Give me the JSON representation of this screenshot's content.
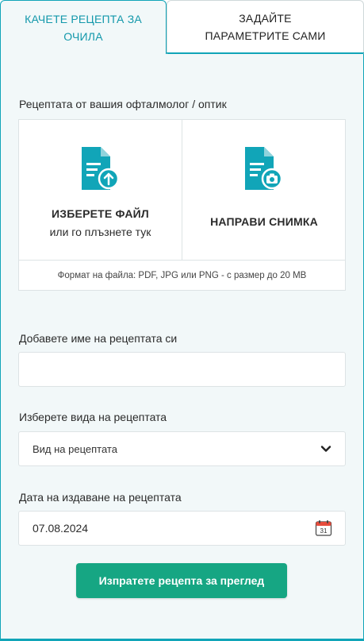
{
  "tabs": {
    "upload": "КАЧЕТЕ РЕЦЕПТА ЗА ОЧИЛА",
    "manual": "ЗАДАЙТЕ ПАРАМЕТРИТЕ САМИ"
  },
  "upload": {
    "section_label": "Рецептата от вашия офталмолог / оптик",
    "file_title": "ИЗБЕРЕТЕ ФАЙЛ",
    "file_subtitle": "или го плъзнете тук",
    "photo_title": "НАПРАВИ СНИМКА",
    "format_note": "Формат на файла: PDF, JPG или PNG - с размер до 20 MB",
    "icon_file": "upload-document-icon",
    "icon_photo": "camera-document-icon"
  },
  "form": {
    "name_label": "Добавете име на рецептата си",
    "name_value": "",
    "type_label": "Изберете вида на рецептата",
    "type_value": "Вид на рецептата",
    "date_label": "Дата на издаване на рецептата",
    "date_value": "07.08.2024",
    "calendar_day": "31"
  },
  "submit_label": "Изпратете рецепта за преглед",
  "colors": {
    "accent": "#11a5b8",
    "submit": "#16a683",
    "panel_bg": "#f2f8f9"
  }
}
